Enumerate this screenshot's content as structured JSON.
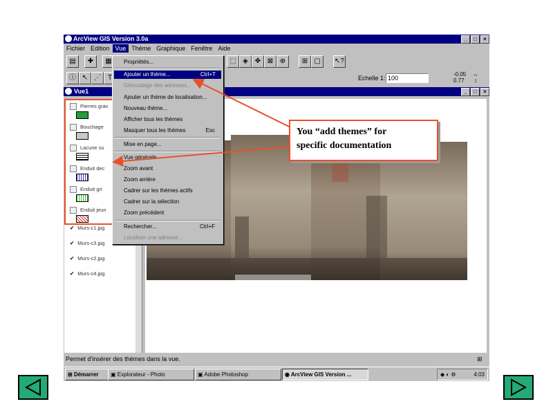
{
  "app": {
    "title": "ArcView GIS Version 3.0a",
    "menus": [
      "Fichier",
      "Edition",
      "Vue",
      "Thème",
      "Graphique",
      "Fenêtre",
      "Aide"
    ],
    "scale_label": "Echelle 1:",
    "scale_value": "100",
    "coords_top": "-0.05",
    "coords_bottom": "0.77"
  },
  "view": {
    "title": "Vue1",
    "themes": [
      {
        "label": "Pierres grav",
        "checked": false,
        "swatch_color": "#2a9a3a"
      },
      {
        "label": "Bouchage",
        "checked": false,
        "swatch_color": "#c8c8c8"
      },
      {
        "label": "Lacune su",
        "checked": false,
        "swatch_color": "#ffffff"
      },
      {
        "label": "Enduit dec",
        "checked": false,
        "swatch_color": "#3030c0"
      },
      {
        "label": "Enduit gri",
        "checked": false,
        "swatch_color": "#30c030"
      },
      {
        "label": "Enduit jeun",
        "checked": false,
        "swatch_color": "#d03030"
      },
      {
        "label": "Murs-c1.jpg",
        "checked": true
      },
      {
        "label": "Murs-c3.jpg",
        "checked": true
      },
      {
        "label": "Murs-c2.jpg",
        "checked": true
      },
      {
        "label": "Murs-c4.jpg",
        "checked": true
      }
    ]
  },
  "menu": {
    "items": [
      {
        "label": "Propriétés...",
        "shortcut": "",
        "disabled": false,
        "selected": false
      },
      {
        "label": "Ajouter un thème...",
        "shortcut": "Ctrl+T",
        "disabled": false,
        "selected": true
      },
      {
        "label": "Géocodage des adresses...",
        "shortcut": "",
        "disabled": true,
        "selected": false
      },
      {
        "label": "Ajouter un thème de localisation...",
        "shortcut": "",
        "disabled": false,
        "selected": false
      },
      {
        "label": "Nouveau thème...",
        "shortcut": "",
        "disabled": false,
        "selected": false
      },
      {
        "label": "Afficher tous les thèmes",
        "shortcut": "",
        "disabled": false,
        "selected": false
      },
      {
        "label": "Masquer tous les thèmes",
        "shortcut": "Esc",
        "disabled": false,
        "selected": false
      },
      {
        "label": "Mise en page...",
        "shortcut": "",
        "disabled": false,
        "selected": false
      },
      {
        "label": "Vue générale",
        "shortcut": "",
        "disabled": false,
        "selected": false
      },
      {
        "label": "Zoom avant",
        "shortcut": "",
        "disabled": false,
        "selected": false
      },
      {
        "label": "Zoom arrière",
        "shortcut": "",
        "disabled": false,
        "selected": false
      },
      {
        "label": "Cadrer sur les thèmes actifs",
        "shortcut": "",
        "disabled": false,
        "selected": false
      },
      {
        "label": "Cadrer sur la sélection",
        "shortcut": "",
        "disabled": false,
        "selected": false
      },
      {
        "label": "Zoom précédent",
        "shortcut": "",
        "disabled": false,
        "selected": false
      },
      {
        "label": "Rechercher...",
        "shortcut": "Ctrl+F",
        "disabled": false,
        "selected": false
      },
      {
        "label": "Localiser une adresse...",
        "shortcut": "",
        "disabled": true,
        "selected": false
      }
    ]
  },
  "statusbar": {
    "text": "Permet d'insérer des thèmes dans la vue."
  },
  "taskbar": {
    "start": "Démarrer",
    "tasks": [
      "Explorateur - Photo",
      "Adobe Photoshop",
      "ArcView GIS Version ..."
    ],
    "clock": "4:03"
  },
  "callout": {
    "line1": "You “add themes” for",
    "line2": "specific documentation"
  },
  "colors": {
    "highlight": "#e8502a",
    "titlebar": "#000080",
    "nav_button": "#22aa77"
  }
}
